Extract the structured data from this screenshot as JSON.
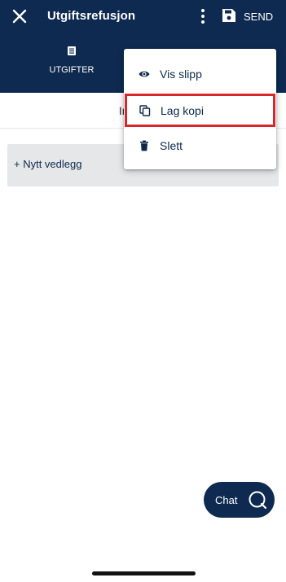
{
  "header": {
    "title": "Utgiftsrefusjon",
    "send_label": "SEND",
    "close_icon": "close-icon",
    "more_icon": "more-vertical-icon",
    "save_icon": "floppy-disk-icon",
    "background": "#0e2a50"
  },
  "tabs": [
    {
      "label": "UTGIFTER",
      "icon": "list-icon"
    }
  ],
  "notice": {
    "text": "Ingen reg"
  },
  "attachments": {
    "new_label": "+ Nytt vedlegg"
  },
  "menu": {
    "items": [
      {
        "label": "Vis slipp",
        "icon": "eye-icon"
      },
      {
        "label": "Lag kopi",
        "icon": "copy-icon",
        "highlighted": true
      },
      {
        "label": "Slett",
        "icon": "trash-icon"
      }
    ],
    "highlight_color": "#d9262b"
  },
  "chat": {
    "label": "Chat",
    "icon": "chat-bubble-icon"
  }
}
